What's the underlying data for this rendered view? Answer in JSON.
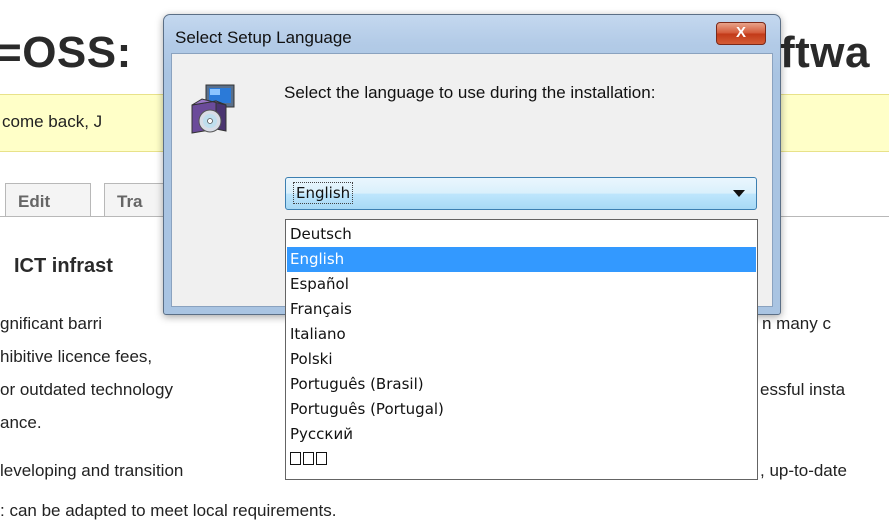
{
  "background_page": {
    "heading_left": "=OSS:",
    "heading_right": "ftwa",
    "notice_text": "come back, J",
    "tabs": [
      "Edit",
      "Tra"
    ],
    "section_heading": "ICT infrast",
    "lines_left": [
      "gnificant barri",
      "hibitive licence fees,",
      " or outdated technology",
      "ance.",
      "leveloping and transition",
      ": can be adapted to meet local requirements."
    ],
    "lines_right": [
      "n many c",
      "essful insta",
      ", up-to-date"
    ]
  },
  "dialog": {
    "title": "Select Setup Language",
    "close_label": "X",
    "prompt": "Select the language to use during the installation:",
    "selected_language": "English",
    "languages": [
      "Deutsch",
      "English",
      "Español",
      "Français",
      "Italiano",
      "Polski",
      "Português (Brasil)",
      "Português (Portugal)",
      "Русский",
      ""
    ],
    "highlighted_index": 1,
    "icon": "setup-installer-icon"
  }
}
